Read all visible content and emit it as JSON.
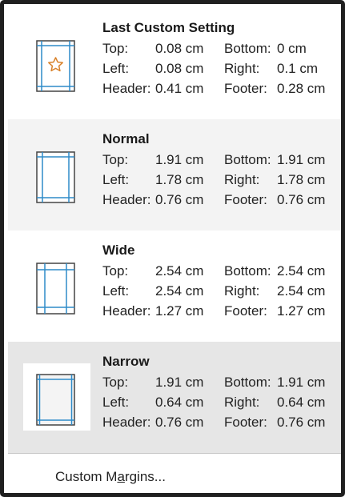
{
  "options": [
    {
      "title": "Last Custom Setting",
      "icon": "star-icon",
      "top_label": "Top:",
      "top": "0.08 cm",
      "bottom_label": "Bottom:",
      "bottom": "0 cm",
      "left_label": "Left:",
      "left": "0.08 cm",
      "right_label": "Right:",
      "right": "0.1 cm",
      "header_label": "Header:",
      "header": "0.41 cm",
      "footer_label": "Footer:",
      "footer": "0.28 cm"
    },
    {
      "title": "Normal",
      "top_label": "Top:",
      "top": "1.91 cm",
      "bottom_label": "Bottom:",
      "bottom": "1.91 cm",
      "left_label": "Left:",
      "left": "1.78 cm",
      "right_label": "Right:",
      "right": "1.78 cm",
      "header_label": "Header:",
      "header": "0.76 cm",
      "footer_label": "Footer:",
      "footer": "0.76 cm"
    },
    {
      "title": "Wide",
      "top_label": "Top:",
      "top": "2.54 cm",
      "bottom_label": "Bottom:",
      "bottom": "2.54 cm",
      "left_label": "Left:",
      "left": "2.54 cm",
      "right_label": "Right:",
      "right": "2.54 cm",
      "header_label": "Header:",
      "header": "1.27 cm",
      "footer_label": "Footer:",
      "footer": "1.27 cm"
    },
    {
      "title": "Narrow",
      "top_label": "Top:",
      "top": "1.91 cm",
      "bottom_label": "Bottom:",
      "bottom": "1.91 cm",
      "left_label": "Left:",
      "left": "0.64 cm",
      "right_label": "Right:",
      "right": "0.64 cm",
      "header_label": "Header:",
      "header": "0.76 cm",
      "footer_label": "Footer:",
      "footer": "0.76 cm"
    }
  ],
  "custom_margins": {
    "label_before": "Custom M",
    "label_mnemonic": "a",
    "label_after": "rgins..."
  },
  "colors": {
    "margin_line": "#2e8bc9",
    "page_border": "#444444",
    "star": "#d9822b",
    "hover_bg": "#e6e6e6",
    "alt_bg": "#f3f3f3"
  }
}
